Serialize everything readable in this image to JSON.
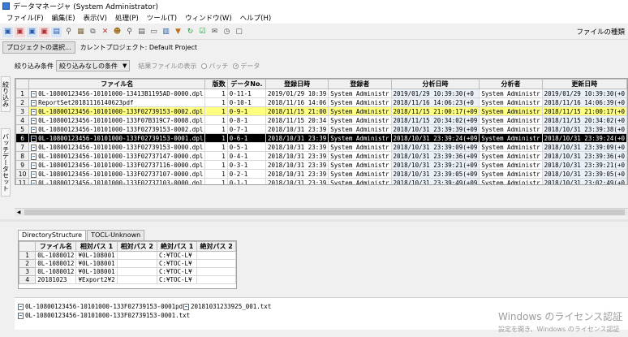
{
  "window": {
    "title": "データマネージャ (System Administrator)"
  },
  "menu": [
    "ファイル(F)",
    "編集(E)",
    "表示(V)",
    "処理(P)",
    "ツール(T)",
    "ウィンドウ(W)",
    "ヘルプ(H)"
  ],
  "toolbar": {
    "file_type_label": "ファイルの種類"
  },
  "project": {
    "select_button": "プロジェクトの選択...",
    "current_label": "カレントプロジェクト: Default Project"
  },
  "side_tabs": [
    "絞り込み",
    "バッチデータセット"
  ],
  "filter": {
    "label": "絞り込み条件",
    "combo_value": "絞り込みなしの条件",
    "result_display_label": "結果ファイルの表示",
    "batch_label": "バッチ",
    "data_label": "データ"
  },
  "main_table": {
    "columns": [
      "ファイル名",
      "版数",
      "データNo.",
      "登録日時",
      "登録者",
      "分析日時",
      "分析者",
      "更新日時"
    ],
    "rows": [
      [
        "0L-10800123456-10101000-13413B1195AD-0000.dpl",
        "1",
        "0-11-1",
        "2019/01/29 10:39",
        "System Administr",
        "2019/01/29 10:39:30(+0",
        "System Administr",
        "2019/01/29 10:39:30(+0"
      ],
      [
        "ReportSet20181116140623pdf",
        "1",
        "0-10-1",
        "2018/11/16 14:06",
        "System Administr",
        "2018/11/16 14:06:23(+0",
        "System Administr",
        "2018/11/16 14:06:39(+0"
      ],
      [
        "0L-10800123456-10101000-133F02739153-0002.dpl",
        "1",
        "0-9-1",
        "2018/11/15 21:00",
        "System Administr",
        "2018/11/15 21:00:17(+09",
        "System Administr",
        "2018/11/15 21:00:17(+0"
      ],
      [
        "0L-10800123456-10101000-133F07B319C7-0008.dpl",
        "1",
        "0-8-1",
        "2018/11/15 20:34",
        "System Administr",
        "2018/11/15 20:34:02(+09",
        "System Administr",
        "2018/11/15 20:34:02(+0"
      ],
      [
        "0L-10800123456-10101000-133F02739153-0002.dpl",
        "1",
        "0-7-1",
        "2018/10/31 23:39",
        "System Administr",
        "2018/10/31 23:39:39(+09",
        "System Administr",
        "2018/10/31 23:39:38(+0"
      ],
      [
        "0L-10800123456-10101000-133F02739153-0001.dpl",
        "1",
        "0-6-1",
        "2018/10/31 23:39",
        "System Administr",
        "2018/10/31 23:39:24(+09",
        "System Administr",
        "2018/10/31 23:39:24(+0"
      ],
      [
        "0L-10800123456-10101000-133F02739153-0000.dpl",
        "1",
        "0-5-1",
        "2018/10/31 23:39",
        "System Administr",
        "2018/10/31 23:39:09(+09",
        "System Administr",
        "2018/10/31 23:39:09(+0"
      ],
      [
        "0L-10800123456-10101000-133F02737147-0000.dpl",
        "1",
        "0-4-1",
        "2018/10/31 23:39",
        "System Administr",
        "2018/10/31 23:39:36(+09",
        "System Administr",
        "2018/10/31 23:39:36(+0"
      ],
      [
        "0L-10800123456-10101000-133F02737116-0000.dpl",
        "1",
        "0-3-1",
        "2018/10/31 23:39",
        "System Administr",
        "2018/10/31 23:39:21(+09",
        "System Administr",
        "2018/10/31 23:39:21(+0"
      ],
      [
        "0L-10800123456-10101000-133F02737107-0000.dpl",
        "1",
        "0-2-1",
        "2018/10/31 23:39",
        "System Administr",
        "2018/10/31 23:39:05(+09",
        "System Administr",
        "2018/10/31 23:39:05(+0"
      ],
      [
        "0L-10800123456-10101000-133F02737103-0000.dpl",
        "1",
        "0-1-1",
        "2018/10/31 23:39",
        "System Administr",
        "2018/10/31 23:39:49(+09",
        "System Administr",
        "2018/10/31 23:02:49(+0"
      ]
    ]
  },
  "tabs": [
    "DirectoryStructure",
    "TOCL-Unknown"
  ],
  "sub_table": {
    "columns": [
      "ファイル名",
      "相対パス 1",
      "相対パス 2",
      "絶対パス 1",
      "絶対パス 2"
    ],
    "rows": [
      [
        "0L-1080012",
        "¥0L-108001",
        "",
        "C:¥TOC-L¥",
        ""
      ],
      [
        "0L-1080012",
        "¥0L-108001",
        "",
        "C:¥TOC-L¥",
        ""
      ],
      [
        "0L-1080012",
        "¥0L-108001",
        "",
        "C:¥TOC-L¥",
        ""
      ],
      [
        "20181023",
        "¥Export2¥2",
        "",
        "C:¥TOC-L¥",
        ""
      ]
    ]
  },
  "attachments": [
    "0L-10800123456-10101000-133F02739153-0001pdf",
    "20181031233925_001.txt",
    "0L-10800123456-10101000-133F02739153-0001.txt"
  ],
  "watermark": {
    "line1": "Windows のライセンス認証",
    "line2": "設定を開き、Windows のライセンス認証"
  }
}
